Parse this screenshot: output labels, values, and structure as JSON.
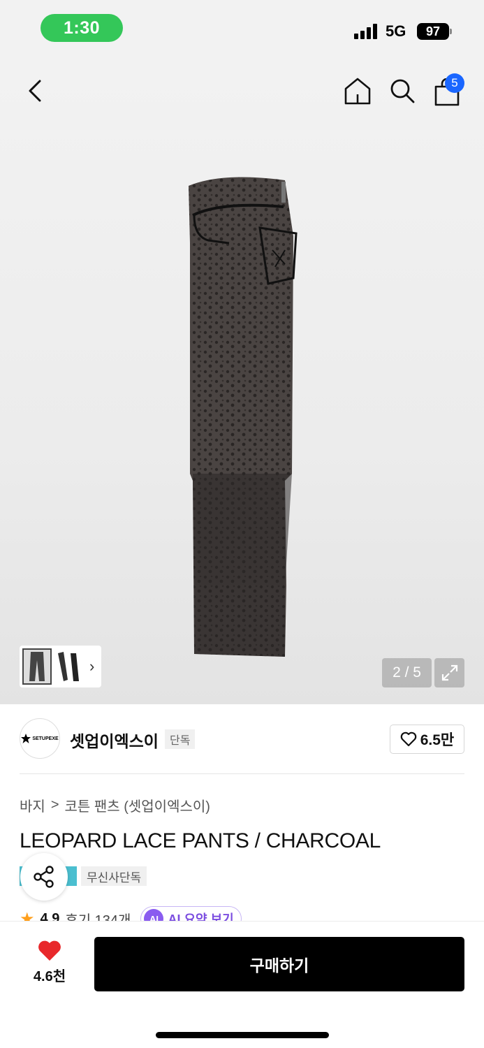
{
  "status_bar": {
    "time": "1:30",
    "network": "5G",
    "battery": "97"
  },
  "header": {
    "cart_count": "5"
  },
  "gallery": {
    "page_counter": "2 / 5"
  },
  "brand": {
    "logo_text": "SETUPEXE",
    "name": "셋업이엑스이",
    "tag": "단독",
    "like_count": "6.5만"
  },
  "breadcrumb": {
    "category": "바지",
    "separator": ">",
    "subcategory": "코튼 팬츠 (셋업이엑스이)"
  },
  "product": {
    "title": "LEOPARD LACE PANTS / CHARCOAL",
    "tag_exclusive": "무신사단독",
    "rating": "4.9",
    "reviews": "후기 134개",
    "ai_summary": "AI 요약 보기"
  },
  "bottom_bar": {
    "wishlist_count": "4.6천",
    "buy_label": "구매하기"
  },
  "colors": {
    "accent_blue": "#1a66ff",
    "heart_red": "#e8282b",
    "star_orange": "#ff9f1c",
    "ai_purple": "#8a5cf0"
  }
}
